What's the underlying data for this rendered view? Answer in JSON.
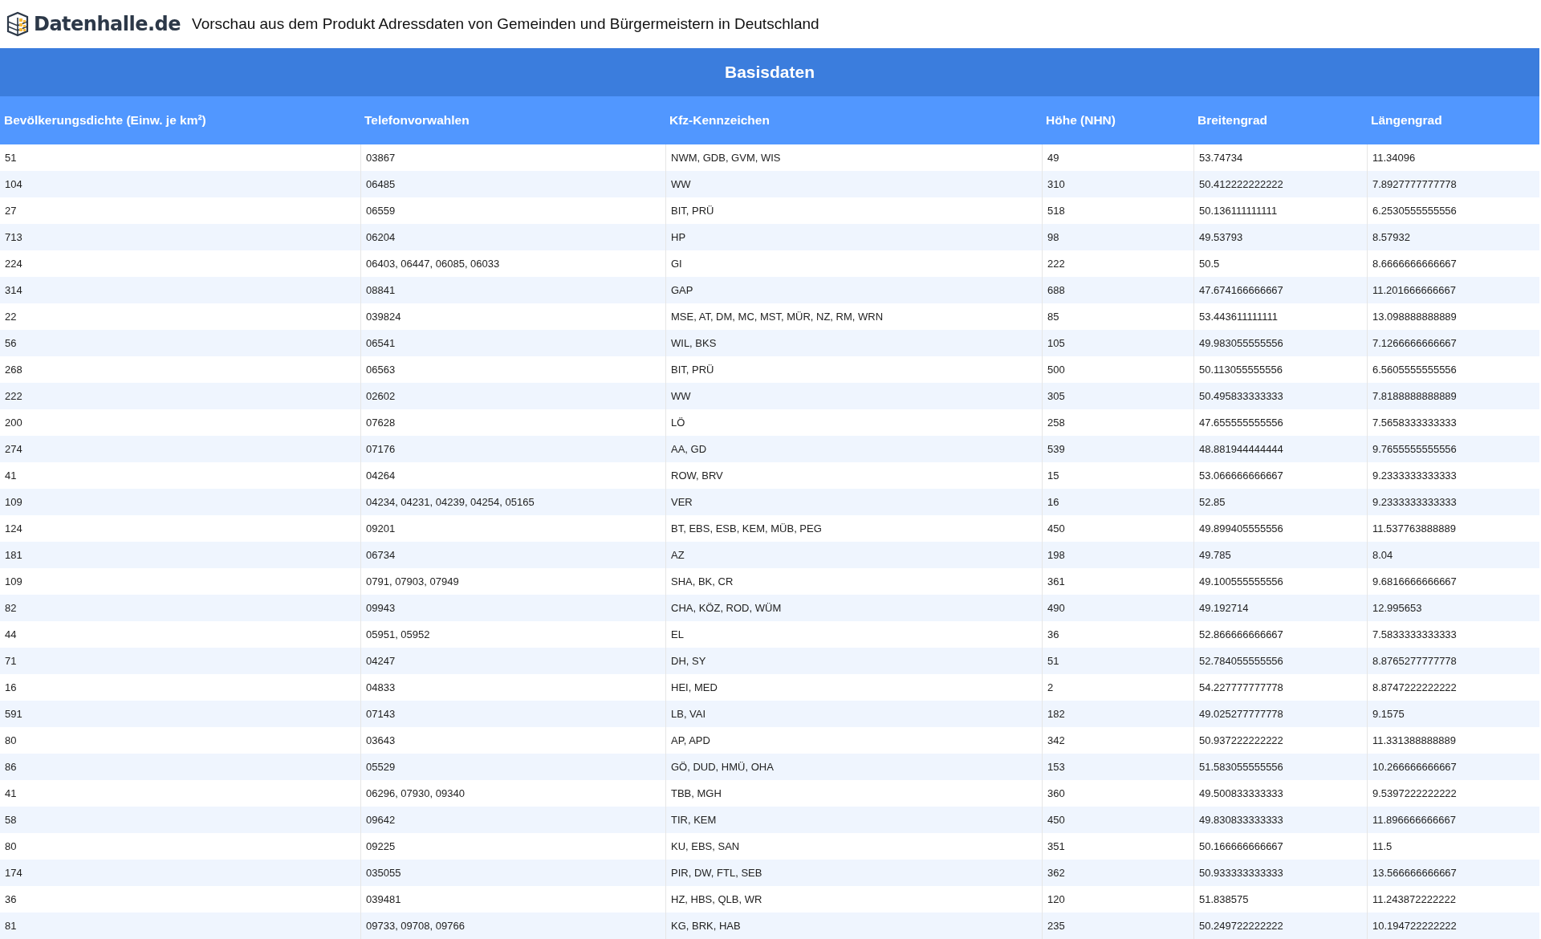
{
  "header": {
    "logo_text": "Datenhalle.de",
    "title": "Vorschau aus dem Produkt Adressdaten von Gemeinden und Bürgermeistern in Deutschland"
  },
  "table": {
    "title": "Basisdaten",
    "columns": [
      "Bevölkerungsdichte (Einw. je km²)",
      "Telefonvorwahlen",
      "Kfz-Kennzeichen",
      "Höhe (NHN)",
      "Breitengrad",
      "Längengrad"
    ],
    "rows": [
      [
        "51",
        "03867",
        "NWM, GDB, GVM, WIS",
        "49",
        "53.74734",
        "11.34096"
      ],
      [
        "104",
        "06485",
        "WW",
        "310",
        "50.412222222222",
        "7.8927777777778"
      ],
      [
        "27",
        "06559",
        "BIT, PRÜ",
        "518",
        "50.136111111111",
        "6.2530555555556"
      ],
      [
        "713",
        "06204",
        "HP",
        "98",
        "49.53793",
        "8.57932"
      ],
      [
        "224",
        "06403, 06447, 06085, 06033",
        "GI",
        "222",
        "50.5",
        "8.6666666666667"
      ],
      [
        "314",
        "08841",
        "GAP",
        "688",
        "47.674166666667",
        "11.201666666667"
      ],
      [
        "22",
        "039824",
        "MSE, AT, DM, MC, MST, MÜR, NZ, RM, WRN",
        "85",
        "53.443611111111",
        "13.098888888889"
      ],
      [
        "56",
        "06541",
        "WIL, BKS",
        "105",
        "49.983055555556",
        "7.1266666666667"
      ],
      [
        "268",
        "06563",
        "BIT, PRÜ",
        "500",
        "50.113055555556",
        "6.5605555555556"
      ],
      [
        "222",
        "02602",
        "WW",
        "305",
        "50.495833333333",
        "7.8188888888889"
      ],
      [
        "200",
        "07628",
        "LÖ",
        "258",
        "47.655555555556",
        "7.5658333333333"
      ],
      [
        "274",
        "07176",
        "AA, GD",
        "539",
        "48.881944444444",
        "9.7655555555556"
      ],
      [
        "41",
        "04264",
        "ROW, BRV",
        "15",
        "53.066666666667",
        "9.2333333333333"
      ],
      [
        "109",
        "04234, 04231, 04239, 04254, 05165",
        "VER",
        "16",
        "52.85",
        "9.2333333333333"
      ],
      [
        "124",
        "09201",
        "BT, EBS, ESB, KEM, MÜB, PEG",
        "450",
        "49.899405555556",
        "11.537763888889"
      ],
      [
        "181",
        "06734",
        "AZ",
        "198",
        "49.785",
        "8.04"
      ],
      [
        "109",
        "0791, 07903, 07949",
        "SHA, BK, CR",
        "361",
        "49.100555555556",
        "9.6816666666667"
      ],
      [
        "82",
        "09943",
        "CHA, KÖZ, ROD, WÜM",
        "490",
        "49.192714",
        "12.995653"
      ],
      [
        "44",
        "05951, 05952",
        "EL",
        "36",
        "52.866666666667",
        "7.5833333333333"
      ],
      [
        "71",
        "04247",
        "DH, SY",
        "51",
        "52.784055555556",
        "8.8765277777778"
      ],
      [
        "16",
        "04833",
        "HEI, MED",
        "2",
        "54.227777777778",
        "8.8747222222222"
      ],
      [
        "591",
        "07143",
        "LB, VAI",
        "182",
        "49.025277777778",
        "9.1575"
      ],
      [
        "80",
        "03643",
        "AP, APD",
        "342",
        "50.937222222222",
        "11.331388888889"
      ],
      [
        "86",
        "05529",
        "GÖ, DUD, HMÜ, OHA",
        "153",
        "51.583055555556",
        "10.266666666667"
      ],
      [
        "41",
        "06296, 07930, 09340",
        "TBB, MGH",
        "360",
        "49.500833333333",
        "9.5397222222222"
      ],
      [
        "58",
        "09642",
        "TIR, KEM",
        "450",
        "49.830833333333",
        "11.896666666667"
      ],
      [
        "80",
        "09225",
        "KU, EBS, SAN",
        "351",
        "50.166666666667",
        "11.5"
      ],
      [
        "174",
        "035055",
        "PIR, DW, FTL, SEB",
        "362",
        "50.933333333333",
        "13.566666666667"
      ],
      [
        "36",
        "039481",
        "HZ, HBS, QLB, WR",
        "120",
        "51.838575",
        "11.243872222222"
      ],
      [
        "81",
        "09733, 09708, 09766",
        "KG, BRK, HAB",
        "235",
        "50.249722222222",
        "10.194722222222"
      ]
    ]
  }
}
